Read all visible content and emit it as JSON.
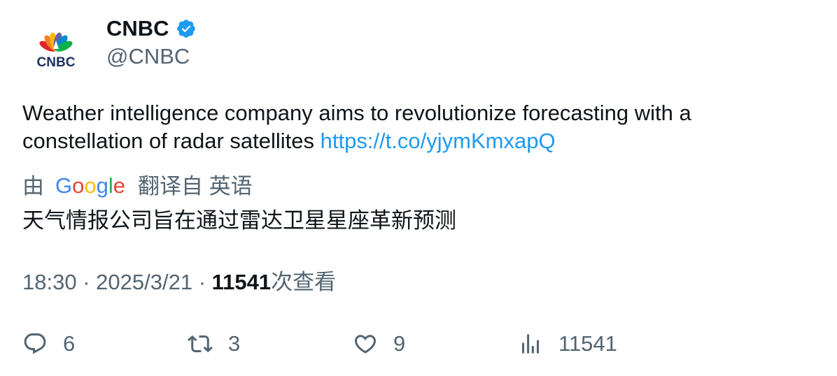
{
  "author": {
    "name": "CNBC",
    "handle": "@CNBC",
    "logo_text": "CNBC"
  },
  "tweet": {
    "text": "Weather intelligence company aims to revolutionize forecasting with a constellation of radar satellites ",
    "link": "https://t.co/yjymKmxapQ"
  },
  "translation": {
    "prefix": "由",
    "provider": "Google",
    "suffix": "翻译自 英语",
    "text": "天气情报公司旨在通过雷达卫星星座革新预测"
  },
  "meta": {
    "time": "18:30",
    "separator": "·",
    "date": "2025/3/21",
    "views": "11541",
    "views_label": "次查看"
  },
  "actions": {
    "replies": "6",
    "retweets": "3",
    "likes": "9",
    "views": "11541"
  },
  "colors": {
    "link": "#1d9bf0",
    "secondary_text": "#536471",
    "verified": "#1d9bf0"
  }
}
